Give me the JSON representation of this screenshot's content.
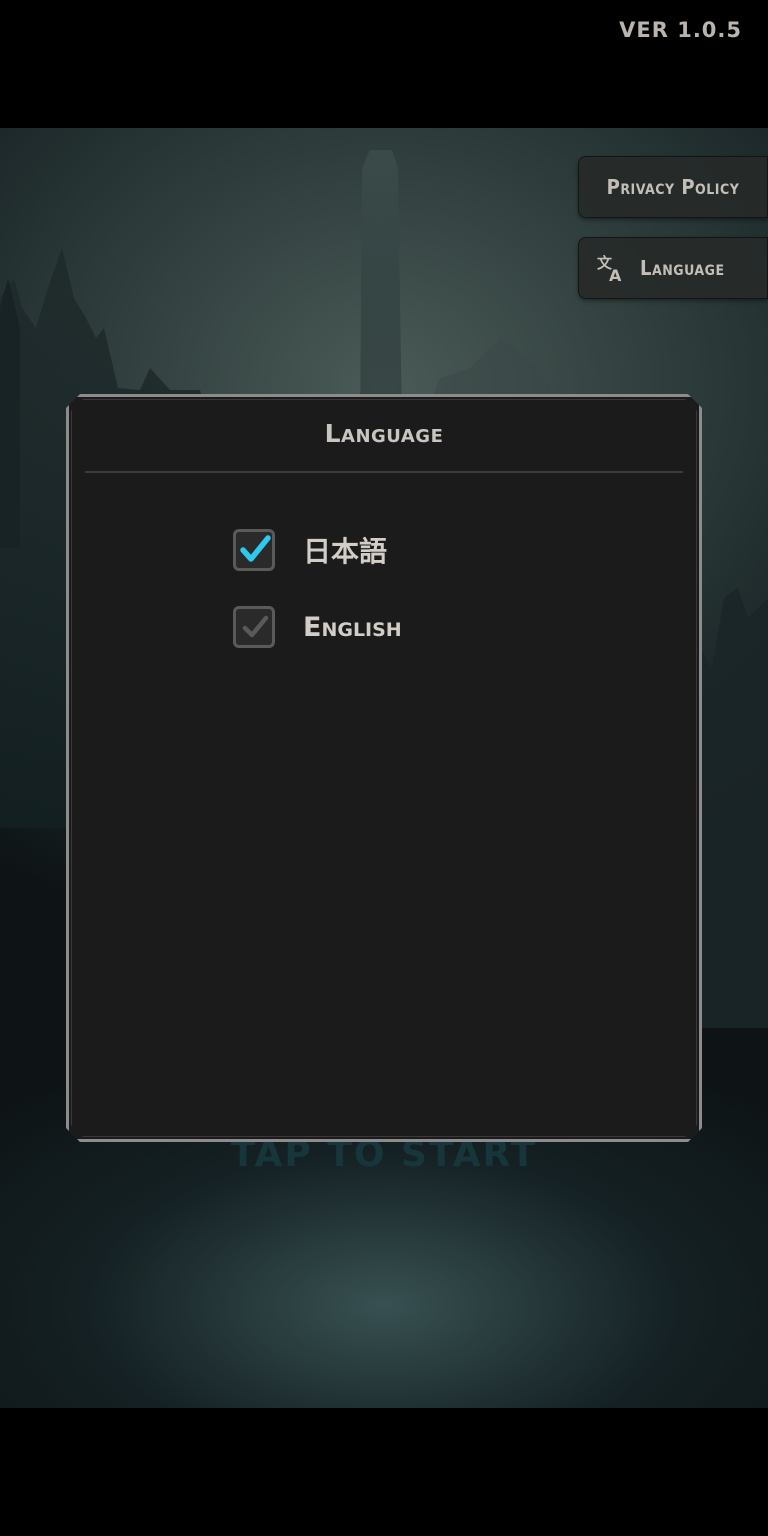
{
  "version_label": "VER 1.0.5",
  "menu": {
    "privacy_label": "Privacy Policy",
    "language_label": "Language"
  },
  "tap_to_start": "TAP TO START",
  "dialog": {
    "title": "Language",
    "options": [
      {
        "label": "日本語",
        "checked": true,
        "check_color": "#2ec9f0"
      },
      {
        "label": "English",
        "checked": false,
        "check_color": "#5a5959"
      }
    ]
  },
  "icons": {
    "translate": "translate-icon",
    "check": "check-icon"
  }
}
